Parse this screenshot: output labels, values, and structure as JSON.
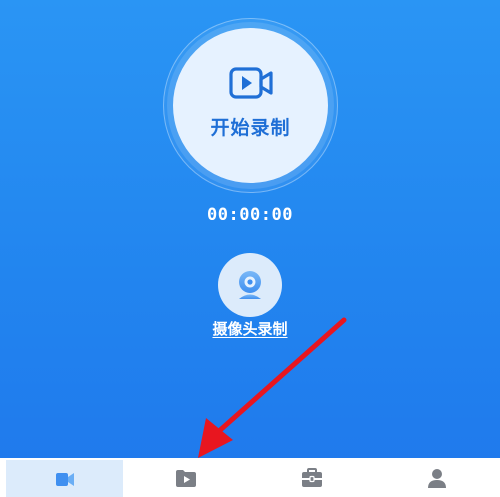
{
  "record": {
    "label": "开始录制",
    "icon": "video-camera-icon"
  },
  "timer": {
    "value": "00:00:00"
  },
  "webcam": {
    "label": "摄像头录制",
    "icon": "webcam-icon"
  },
  "tabbar": {
    "tabs": [
      {
        "icon": "record-tab-icon",
        "active": true
      },
      {
        "icon": "folder-play-icon",
        "active": false
      },
      {
        "icon": "toolbox-icon",
        "active": false
      },
      {
        "icon": "person-icon",
        "active": false
      }
    ]
  },
  "colors": {
    "accent": "#1f6fd6",
    "background": "#2285ef",
    "annotation_arrow": "#e8161f"
  }
}
